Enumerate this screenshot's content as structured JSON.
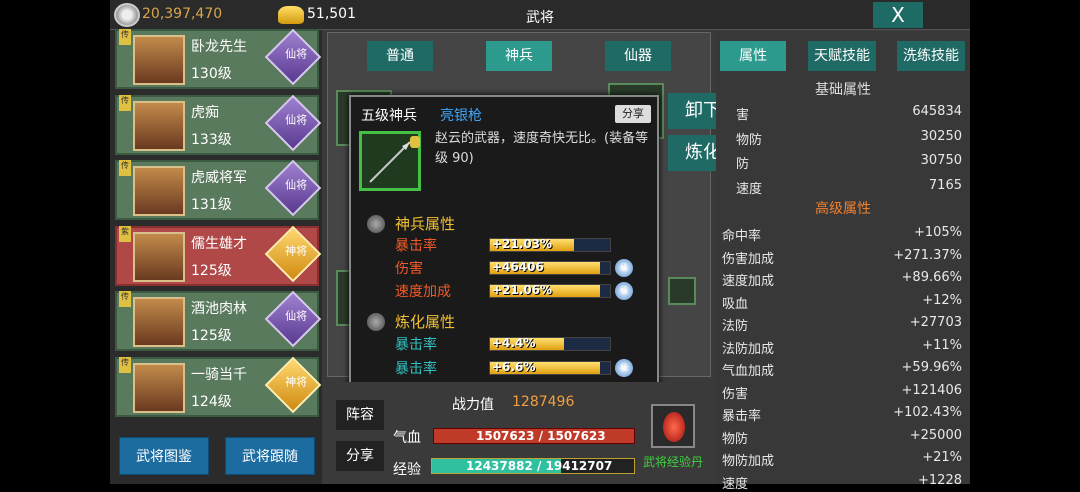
{
  "topbar": {
    "silver": "20,397,470",
    "gold": "51,501",
    "title": "武将",
    "close": "X"
  },
  "heroes": [
    {
      "name": "卧龙先生",
      "level": "130级",
      "rank": "仙将",
      "tag": "传"
    },
    {
      "name": "虎痴",
      "level": "133级",
      "rank": "仙将",
      "tag": "传"
    },
    {
      "name": "虎威将军",
      "level": "131级",
      "rank": "仙将",
      "tag": "传"
    },
    {
      "name": "儒生雄才",
      "level": "125级",
      "rank": "神将",
      "tag": "紫"
    },
    {
      "name": "酒池肉林",
      "level": "125级",
      "rank": "仙将",
      "tag": "传"
    },
    {
      "name": "一骑当千",
      "level": "124级",
      "rank": "神将",
      "tag": "传"
    }
  ],
  "left_buttons": {
    "collection": "武将图鉴",
    "follow": "武将跟随"
  },
  "mid_tabs": [
    "普通",
    "神兵",
    "仙器"
  ],
  "side_buttons": {
    "unequip": "卸下",
    "refine": "炼化"
  },
  "popup": {
    "level": "五级神兵",
    "name": "亮银枪",
    "share": "分享",
    "desc": "赵云的武器，速度奇快无比。(装备等级 90)",
    "sec1": "神兵属性",
    "sec2": "炼化属性",
    "attrs": [
      {
        "label": "暴击率",
        "value": "+21.03%",
        "fill": 0.7,
        "color": "#f05a28",
        "gem": ""
      },
      {
        "label": "伤害",
        "value": "+46406",
        "fill": 0.92,
        "color": "#f05a28",
        "gem": "极"
      },
      {
        "label": "速度加成",
        "value": "+21.06%",
        "fill": 0.92,
        "color": "#f05a28",
        "gem": "极"
      },
      {
        "label": "暴击率",
        "value": "+4.4%",
        "fill": 0.62,
        "color": "#30c0c0",
        "gem": ""
      },
      {
        "label": "暴击率",
        "value": "+6.6%",
        "fill": 0.92,
        "color": "#30c0c0",
        "gem": "极"
      }
    ]
  },
  "bottom": {
    "formation": "阵容",
    "share": "分享",
    "power_label": "战力值",
    "power": "1287496",
    "hp_label": "气血",
    "hp": "1507623 / 1507623",
    "exp_label": "经验",
    "exp": "12437882 / 19412707",
    "exp_item": "武将经验丹"
  },
  "right_tabs": [
    "属性",
    "天赋技能",
    "洗练技能"
  ],
  "basic_title": "基础属性",
  "basic": [
    [
      "害",
      "645834"
    ],
    [
      "物防",
      "30250"
    ],
    [
      "防",
      "30750"
    ],
    [
      "速度",
      "7165"
    ]
  ],
  "adv_title": "高级属性",
  "advanced": [
    [
      "命中率",
      "+105%"
    ],
    [
      "伤害加成",
      "+271.37%"
    ],
    [
      "速度加成",
      "+89.66%"
    ],
    [
      "吸血",
      "+12%"
    ],
    [
      "法防",
      "+27703"
    ],
    [
      "法防加成",
      "+11%"
    ],
    [
      "气血加成",
      "+59.96%"
    ],
    [
      "伤害",
      "+121406"
    ],
    [
      "暴击率",
      "+102.43%"
    ],
    [
      "物防",
      "+25000"
    ],
    [
      "物防加成",
      "+21%"
    ],
    [
      "速度",
      "+1228"
    ]
  ]
}
